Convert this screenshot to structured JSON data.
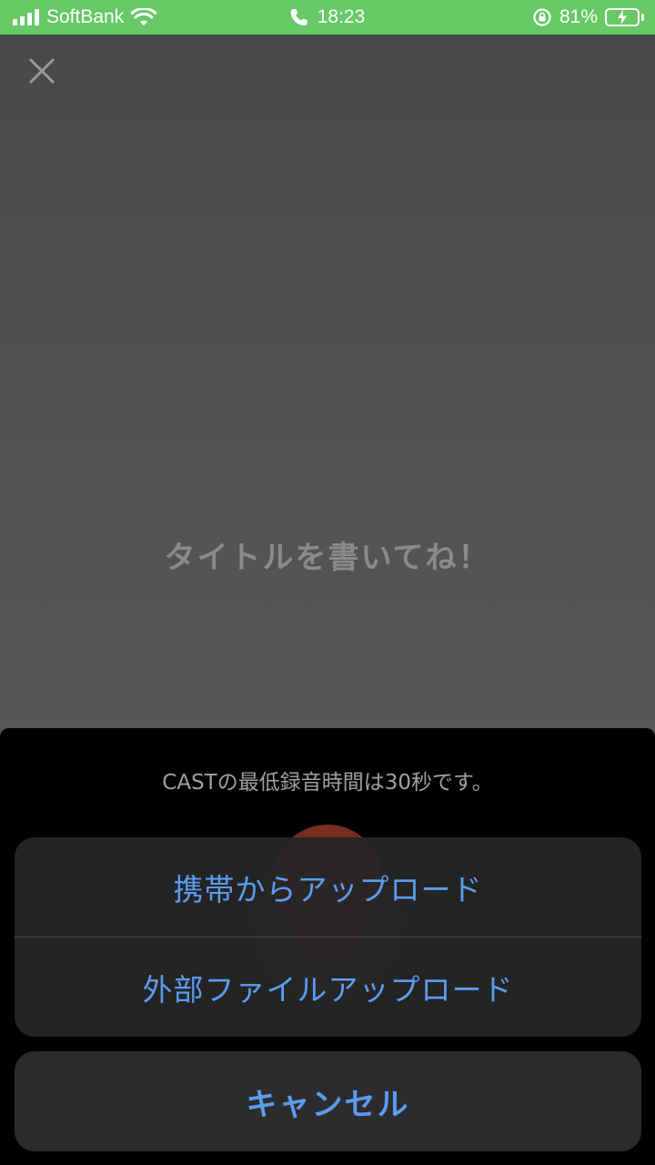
{
  "status_bar": {
    "carrier": "SoftBank",
    "time": "18:23",
    "battery_percent": "81%",
    "background_color": "#66c966"
  },
  "editor": {
    "title_placeholder": "タイトルを書いてね！"
  },
  "sheet": {
    "note": "CASTの最低録音時間は30秒です。"
  },
  "action_sheet": {
    "items": [
      {
        "label": "携帯からアップロード"
      },
      {
        "label": "外部ファイルアップロード"
      }
    ],
    "cancel_label": "キャンセル",
    "accent_color": "#5b9cf0"
  },
  "icons": {
    "close": "close-icon",
    "signal": "cellular-signal-icon",
    "wifi": "wifi-icon",
    "call": "phone-call-icon",
    "rotation_lock": "rotation-lock-icon",
    "battery": "battery-charging-icon"
  }
}
